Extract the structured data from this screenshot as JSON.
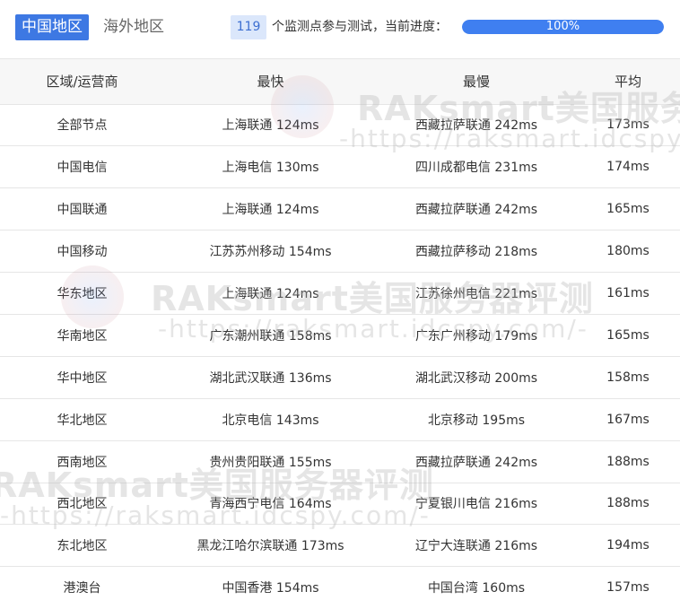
{
  "tabs": [
    {
      "label": "中国地区",
      "active": true
    },
    {
      "label": "海外地区",
      "active": false
    }
  ],
  "status": {
    "monitor_count": "119",
    "text": "个监测点参与测试，当前进度：",
    "progress_label": "100%",
    "progress_value": 1.0
  },
  "table": {
    "headers": [
      "区域/运营商",
      "最快",
      "最慢",
      "平均"
    ],
    "rows": [
      [
        "全部节点",
        "上海联通 124ms",
        "西藏拉萨联通 242ms",
        "173ms"
      ],
      [
        "中国电信",
        "上海电信 130ms",
        "四川成都电信 231ms",
        "174ms"
      ],
      [
        "中国联通",
        "上海联通 124ms",
        "西藏拉萨联通 242ms",
        "165ms"
      ],
      [
        "中国移动",
        "江苏苏州移动 154ms",
        "西藏拉萨移动 218ms",
        "180ms"
      ],
      [
        "华东地区",
        "上海联通 124ms",
        "江苏徐州电信 221ms",
        "161ms"
      ],
      [
        "华南地区",
        "广东潮州联通 158ms",
        "广东广州移动 179ms",
        "165ms"
      ],
      [
        "华中地区",
        "湖北武汉联通 136ms",
        "湖北武汉移动 200ms",
        "158ms"
      ],
      [
        "华北地区",
        "北京电信 143ms",
        "北京移动 195ms",
        "167ms"
      ],
      [
        "西南地区",
        "贵州贵阳联通 155ms",
        "西藏拉萨联通 242ms",
        "188ms"
      ],
      [
        "西北地区",
        "青海西宁电信 164ms",
        "宁夏银川电信 216ms",
        "188ms"
      ],
      [
        "东北地区",
        "黑龙江哈尔滨联通 173ms",
        "辽宁大连联通 216ms",
        "194ms"
      ],
      [
        "港澳台",
        "中国香港 154ms",
        "中国台湾 160ms",
        "157ms"
      ]
    ]
  },
  "watermark": {
    "title": "RAKsmart美国服务器评测",
    "url": "-https://raksmart.idcspy.com/-"
  },
  "colors": {
    "accent": "#3d78e3",
    "progress": "#3f7ff0",
    "badge_bg": "#dbe7fb"
  }
}
